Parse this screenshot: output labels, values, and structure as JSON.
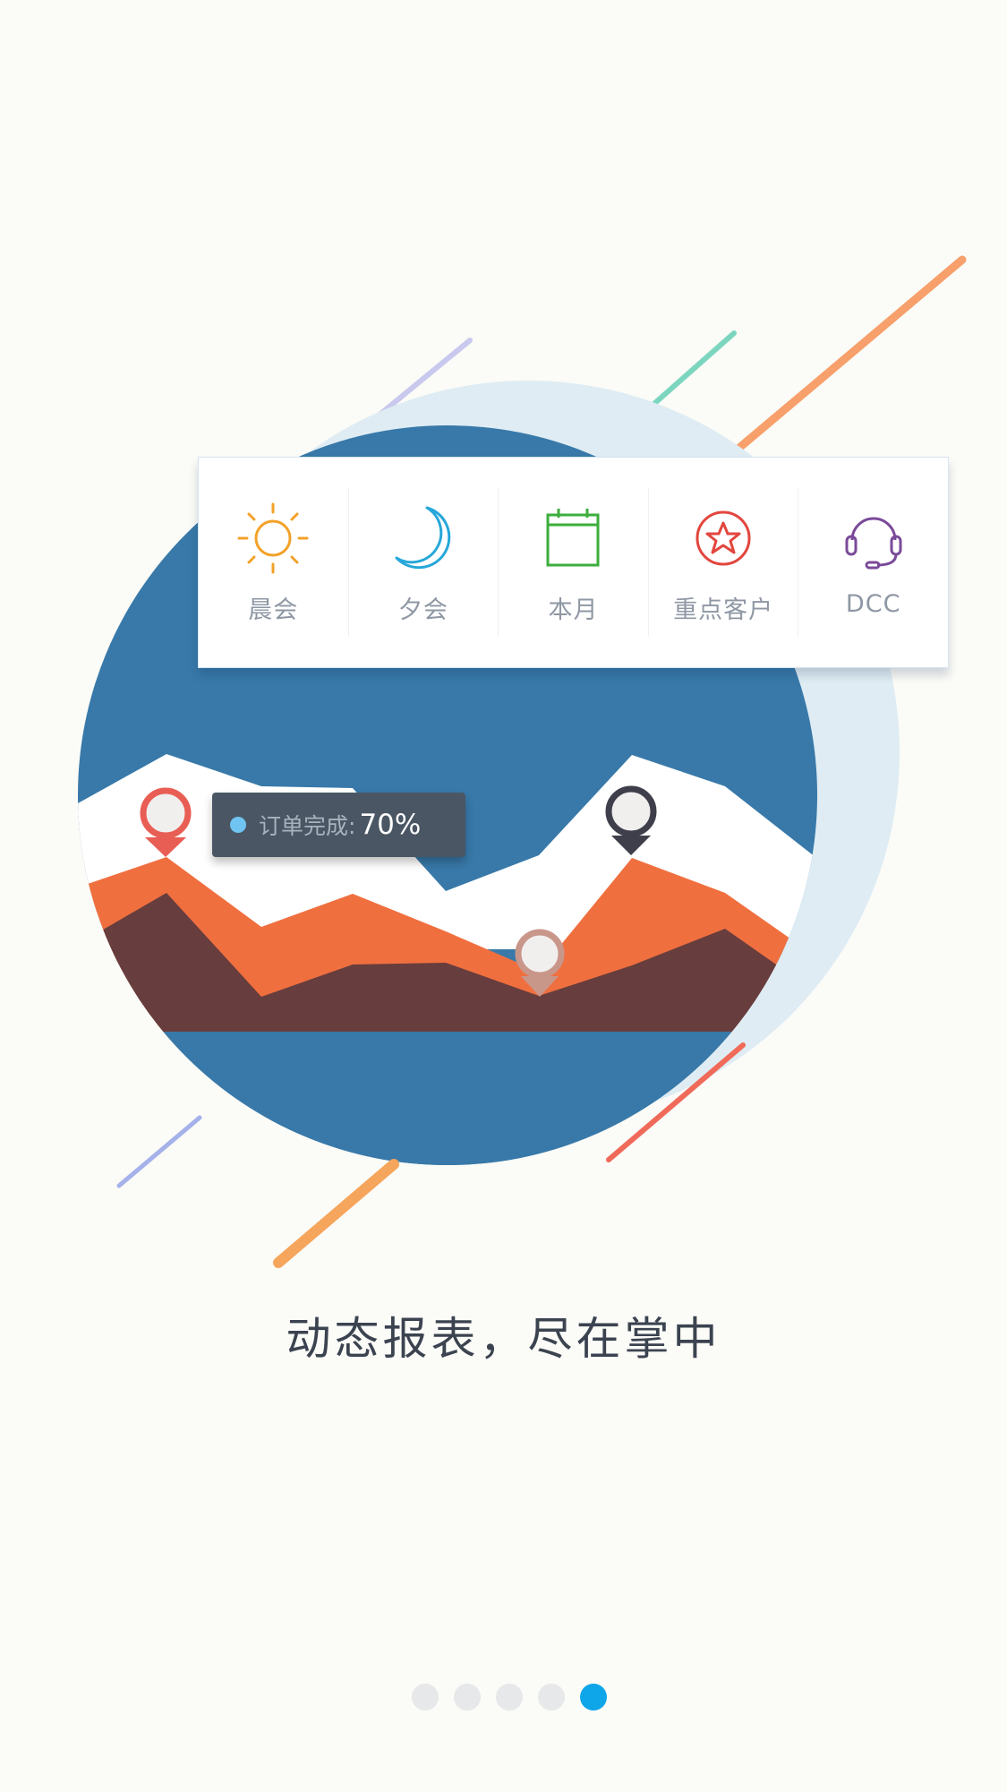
{
  "quick_menu": {
    "items": [
      {
        "label": "晨会",
        "icon": "sun-icon",
        "color": "#f3a229"
      },
      {
        "label": "夕会",
        "icon": "moon-icon",
        "color": "#27a7d9"
      },
      {
        "label": "本月",
        "icon": "calendar-icon",
        "color": "#3cae3c"
      },
      {
        "label": "重点客户",
        "icon": "star-circle-icon",
        "color": "#e2463e"
      },
      {
        "label": "DCC",
        "icon": "headset-icon",
        "color": "#7a4a99"
      }
    ]
  },
  "tooltip": {
    "label": "订单完成:",
    "value": "70%",
    "dot_color": "#6fc4f1"
  },
  "tagline": "动态报表，尽在掌中",
  "pager": {
    "total": 5,
    "active_index": 4,
    "active_color": "#0ea5e9"
  },
  "colors": {
    "background": "#fbfbf7",
    "circle_blue": "#3879a9",
    "circle_light": "#dfecf3",
    "mountain_white": "#ffffff",
    "mountain_orange": "#f06f3f",
    "mountain_brown": "#673d3d"
  }
}
